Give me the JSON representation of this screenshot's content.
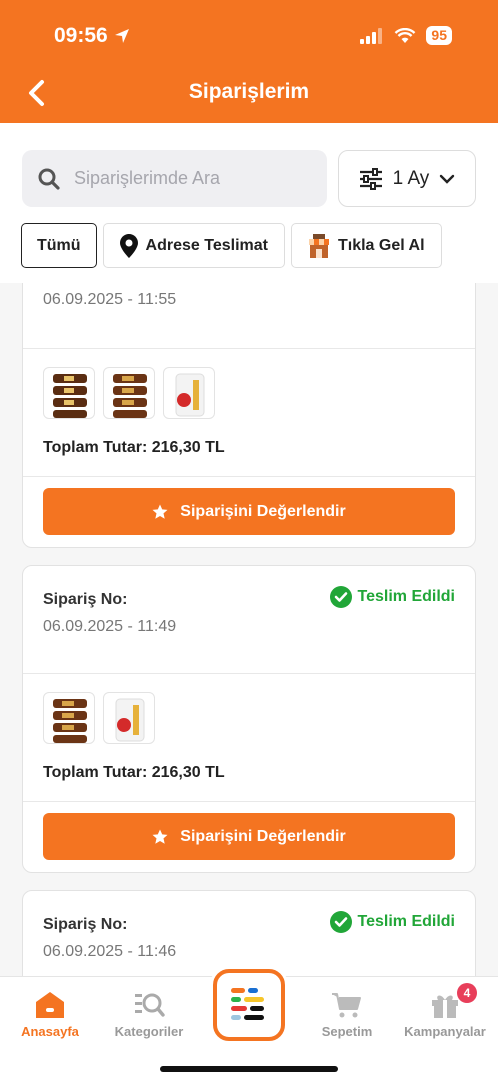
{
  "status_bar": {
    "time": "09:56",
    "battery": "95"
  },
  "header": {
    "title": "Siparişlerim"
  },
  "search": {
    "placeholder": "Siparişlerimde Ara"
  },
  "period": {
    "label": "1 Ay"
  },
  "chips": [
    {
      "label": "Tümü"
    },
    {
      "label": "Adrese Teslimat"
    },
    {
      "label": "Tıkla Gel Al"
    }
  ],
  "orders": [
    {
      "number_label": "",
      "status": "",
      "date": "06.09.2025 - 11:55",
      "total": "Toplam Tutar: 216,30 TL",
      "rate_label": "Siparişini Değerlendir"
    },
    {
      "number_label": "Sipariş No:",
      "status": "Teslim Edildi",
      "date": "06.09.2025 - 11:49",
      "total": "Toplam Tutar: 216,30 TL",
      "rate_label": "Siparişini Değerlendir"
    },
    {
      "number_label": "Sipariş No:",
      "status": "Teslim Edildi",
      "date": "06.09.2025 - 11:46",
      "total": "",
      "rate_label": ""
    }
  ],
  "bottom_nav": [
    {
      "label": "Anasayfa",
      "icon": "home-icon"
    },
    {
      "label": "Kategoriler",
      "icon": "categories-icon"
    },
    {
      "label": "",
      "icon": "menu-logo-icon"
    },
    {
      "label": "Sepetim",
      "icon": "cart-icon"
    },
    {
      "label": "Kampanyalar",
      "icon": "gift-icon",
      "badge": "4"
    }
  ],
  "colors": {
    "brand": "#f47421",
    "success": "#21a638",
    "badge": "#e83e5a"
  }
}
